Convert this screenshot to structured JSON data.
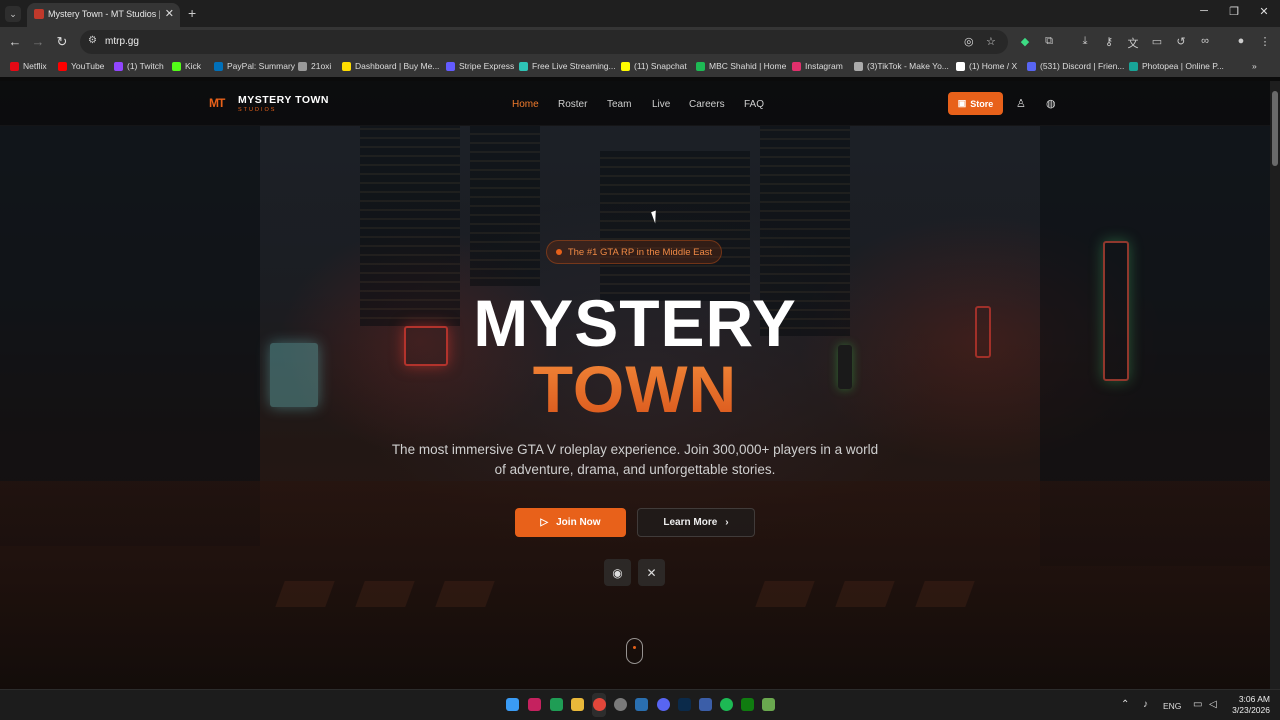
{
  "browser": {
    "tab_title": "Mystery Town - MT Studios | M",
    "tab_close": "✕",
    "new_tab": "+",
    "tab_menu": "⌄",
    "url": "mtrp.gg",
    "window_controls": {
      "minimize": "─",
      "restore": "❐",
      "close": "✕"
    },
    "nav": {
      "back": "←",
      "forward": "→",
      "reload": "↻"
    },
    "bookmarks": [
      {
        "label": "Netflix",
        "color": "#e50914"
      },
      {
        "label": "YouTube",
        "color": "#ff0000"
      },
      {
        "label": "(1) Twitch",
        "color": "#9146ff"
      },
      {
        "label": "Kick",
        "color": "#53fc18"
      },
      {
        "label": "PayPal: Summary",
        "color": "#0070ba"
      },
      {
        "label": "21oxi",
        "color": "#9a9a9a"
      },
      {
        "label": "Dashboard | Buy Me...",
        "color": "#ffdd00"
      },
      {
        "label": "Stripe Express",
        "color": "#635bff"
      },
      {
        "label": "Free Live Streaming...",
        "color": "#2ec4b6"
      },
      {
        "label": "(11) Snapchat",
        "color": "#fffc00"
      },
      {
        "label": "MBC Shahid | Home",
        "color": "#1db954"
      },
      {
        "label": "Instagram",
        "color": "#e1306c"
      },
      {
        "label": "(3)TikTok - Make Yo...",
        "color": "#aaaaaa"
      },
      {
        "label": "(1) Home / X",
        "color": "#ffffff"
      },
      {
        "label": "(531) Discord | Frien...",
        "color": "#5865f2"
      },
      {
        "label": "Photopea | Online P...",
        "color": "#18a497"
      }
    ],
    "bookmarks_more": "»"
  },
  "site": {
    "logo_mark": "MT",
    "logo_title": "MYSTERY TOWN",
    "logo_sub": "STUDIOS",
    "nav_links": [
      "Home",
      "Roster",
      "Team",
      "Live",
      "Careers",
      "FAQ"
    ],
    "store_label": "Store",
    "badge": "The #1 GTA RP in the Middle East",
    "hero_line1": "MYSTERY",
    "hero_line2": "TOWN",
    "description": "The most immersive GTA V roleplay experience. Join 300,000+ players in a world of adventure, drama, and unforgettable stories.",
    "join_label": "Join Now",
    "learn_label": "Learn More",
    "accent": "#e8611a"
  },
  "taskbar": {
    "language": "ENG",
    "time": "3:06 AM",
    "date": "3/23/2026",
    "tray_chevron": "⌃"
  }
}
